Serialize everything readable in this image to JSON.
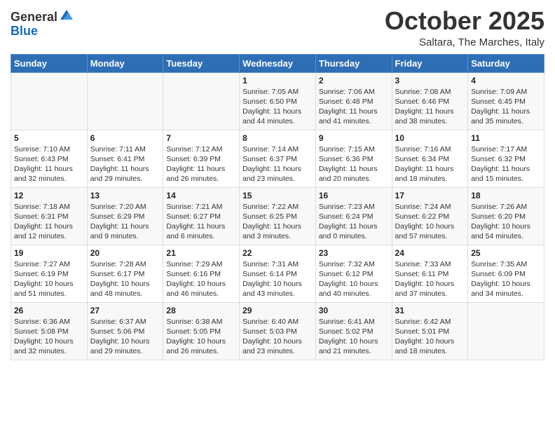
{
  "logo": {
    "line1": "General",
    "line2": "Blue"
  },
  "title": "October 2025",
  "subtitle": "Saltara, The Marches, Italy",
  "days_of_week": [
    "Sunday",
    "Monday",
    "Tuesday",
    "Wednesday",
    "Thursday",
    "Friday",
    "Saturday"
  ],
  "weeks": [
    [
      {
        "day": "",
        "info": ""
      },
      {
        "day": "",
        "info": ""
      },
      {
        "day": "",
        "info": ""
      },
      {
        "day": "1",
        "info": "Sunrise: 7:05 AM\nSunset: 6:50 PM\nDaylight: 11 hours and 44 minutes."
      },
      {
        "day": "2",
        "info": "Sunrise: 7:06 AM\nSunset: 6:48 PM\nDaylight: 11 hours and 41 minutes."
      },
      {
        "day": "3",
        "info": "Sunrise: 7:08 AM\nSunset: 6:46 PM\nDaylight: 11 hours and 38 minutes."
      },
      {
        "day": "4",
        "info": "Sunrise: 7:09 AM\nSunset: 6:45 PM\nDaylight: 11 hours and 35 minutes."
      }
    ],
    [
      {
        "day": "5",
        "info": "Sunrise: 7:10 AM\nSunset: 6:43 PM\nDaylight: 11 hours and 32 minutes."
      },
      {
        "day": "6",
        "info": "Sunrise: 7:11 AM\nSunset: 6:41 PM\nDaylight: 11 hours and 29 minutes."
      },
      {
        "day": "7",
        "info": "Sunrise: 7:12 AM\nSunset: 6:39 PM\nDaylight: 11 hours and 26 minutes."
      },
      {
        "day": "8",
        "info": "Sunrise: 7:14 AM\nSunset: 6:37 PM\nDaylight: 11 hours and 23 minutes."
      },
      {
        "day": "9",
        "info": "Sunrise: 7:15 AM\nSunset: 6:36 PM\nDaylight: 11 hours and 20 minutes."
      },
      {
        "day": "10",
        "info": "Sunrise: 7:16 AM\nSunset: 6:34 PM\nDaylight: 11 hours and 18 minutes."
      },
      {
        "day": "11",
        "info": "Sunrise: 7:17 AM\nSunset: 6:32 PM\nDaylight: 11 hours and 15 minutes."
      }
    ],
    [
      {
        "day": "12",
        "info": "Sunrise: 7:18 AM\nSunset: 6:31 PM\nDaylight: 11 hours and 12 minutes."
      },
      {
        "day": "13",
        "info": "Sunrise: 7:20 AM\nSunset: 6:29 PM\nDaylight: 11 hours and 9 minutes."
      },
      {
        "day": "14",
        "info": "Sunrise: 7:21 AM\nSunset: 6:27 PM\nDaylight: 11 hours and 6 minutes."
      },
      {
        "day": "15",
        "info": "Sunrise: 7:22 AM\nSunset: 6:25 PM\nDaylight: 11 hours and 3 minutes."
      },
      {
        "day": "16",
        "info": "Sunrise: 7:23 AM\nSunset: 6:24 PM\nDaylight: 11 hours and 0 minutes."
      },
      {
        "day": "17",
        "info": "Sunrise: 7:24 AM\nSunset: 6:22 PM\nDaylight: 10 hours and 57 minutes."
      },
      {
        "day": "18",
        "info": "Sunrise: 7:26 AM\nSunset: 6:20 PM\nDaylight: 10 hours and 54 minutes."
      }
    ],
    [
      {
        "day": "19",
        "info": "Sunrise: 7:27 AM\nSunset: 6:19 PM\nDaylight: 10 hours and 51 minutes."
      },
      {
        "day": "20",
        "info": "Sunrise: 7:28 AM\nSunset: 6:17 PM\nDaylight: 10 hours and 48 minutes."
      },
      {
        "day": "21",
        "info": "Sunrise: 7:29 AM\nSunset: 6:16 PM\nDaylight: 10 hours and 46 minutes."
      },
      {
        "day": "22",
        "info": "Sunrise: 7:31 AM\nSunset: 6:14 PM\nDaylight: 10 hours and 43 minutes."
      },
      {
        "day": "23",
        "info": "Sunrise: 7:32 AM\nSunset: 6:12 PM\nDaylight: 10 hours and 40 minutes."
      },
      {
        "day": "24",
        "info": "Sunrise: 7:33 AM\nSunset: 6:11 PM\nDaylight: 10 hours and 37 minutes."
      },
      {
        "day": "25",
        "info": "Sunrise: 7:35 AM\nSunset: 6:09 PM\nDaylight: 10 hours and 34 minutes."
      }
    ],
    [
      {
        "day": "26",
        "info": "Sunrise: 6:36 AM\nSunset: 5:08 PM\nDaylight: 10 hours and 32 minutes."
      },
      {
        "day": "27",
        "info": "Sunrise: 6:37 AM\nSunset: 5:06 PM\nDaylight: 10 hours and 29 minutes."
      },
      {
        "day": "28",
        "info": "Sunrise: 6:38 AM\nSunset: 5:05 PM\nDaylight: 10 hours and 26 minutes."
      },
      {
        "day": "29",
        "info": "Sunrise: 6:40 AM\nSunset: 5:03 PM\nDaylight: 10 hours and 23 minutes."
      },
      {
        "day": "30",
        "info": "Sunrise: 6:41 AM\nSunset: 5:02 PM\nDaylight: 10 hours and 21 minutes."
      },
      {
        "day": "31",
        "info": "Sunrise: 6:42 AM\nSunset: 5:01 PM\nDaylight: 10 hours and 18 minutes."
      },
      {
        "day": "",
        "info": ""
      }
    ]
  ]
}
